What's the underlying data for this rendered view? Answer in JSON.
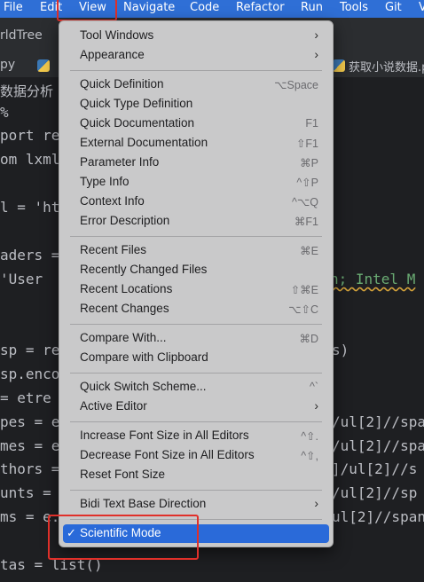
{
  "menubar": {
    "items": [
      "File",
      "Edit",
      "View",
      "Navigate",
      "Code",
      "Refactor",
      "Run",
      "Tools",
      "Git",
      "V"
    ]
  },
  "editor": {
    "project_crumb": "rldTree",
    "tabs": [
      "py",
      "获取小说数据.py"
    ],
    "breadcrumb": "数据分析",
    "lines": [
      {
        "t": "%"
      },
      {
        "t": "port re"
      },
      {
        "t": "om lxml"
      },
      {
        "t": ""
      },
      {
        "t": "l = 'ht"
      },
      {
        "t": ""
      },
      {
        "t": "aders ="
      },
      {
        "t": "  'User",
        "tail": "h; Intel M"
      },
      {
        "t": ""
      },
      {
        "t": ""
      },
      {
        "t": "sp = re",
        "tail": "s)"
      },
      {
        "t": "sp.enco"
      },
      {
        "t": " = etre"
      },
      {
        "t": "pes = e",
        "tail": "/ul[2]//spa"
      },
      {
        "t": "mes = e",
        "tail": "/ul[2]//spa"
      },
      {
        "t": "thors =",
        "tail": "]/ul[2]//s"
      },
      {
        "t": "unts =",
        "tail": "/ul[2]//sp"
      },
      {
        "t": "ms = e.",
        "tail": "ul[2]//span"
      },
      {
        "t": ""
      },
      {
        "t": "tas = list()"
      }
    ]
  },
  "menu": {
    "groups": [
      [
        {
          "label": "Tool Windows",
          "shortcut": "",
          "submenu": true
        },
        {
          "label": "Appearance",
          "shortcut": "",
          "submenu": true
        }
      ],
      [
        {
          "label": "Quick Definition",
          "shortcut": "⌥Space"
        },
        {
          "label": "Quick Type Definition",
          "shortcut": ""
        },
        {
          "label": "Quick Documentation",
          "shortcut": "F1"
        },
        {
          "label": "External Documentation",
          "shortcut": "⇧F1"
        },
        {
          "label": "Parameter Info",
          "shortcut": "⌘P"
        },
        {
          "label": "Type Info",
          "shortcut": "^⇧P"
        },
        {
          "label": "Context Info",
          "shortcut": "^⌥Q"
        },
        {
          "label": "Error Description",
          "shortcut": "⌘F1"
        }
      ],
      [
        {
          "label": "Recent Files",
          "shortcut": "⌘E"
        },
        {
          "label": "Recently Changed Files",
          "shortcut": ""
        },
        {
          "label": "Recent Locations",
          "shortcut": "⇧⌘E"
        },
        {
          "label": "Recent Changes",
          "shortcut": "⌥⇧C"
        }
      ],
      [
        {
          "label": "Compare With...",
          "shortcut": "⌘D"
        },
        {
          "label": "Compare with Clipboard",
          "shortcut": ""
        }
      ],
      [
        {
          "label": "Quick Switch Scheme...",
          "shortcut": "^`"
        },
        {
          "label": "Active Editor",
          "shortcut": "",
          "submenu": true
        }
      ],
      [
        {
          "label": "Increase Font Size in All Editors",
          "shortcut": "^⇧."
        },
        {
          "label": "Decrease Font Size in All Editors",
          "shortcut": "^⇧,"
        },
        {
          "label": "Reset Font Size",
          "shortcut": ""
        }
      ],
      [
        {
          "label": "Bidi Text Base Direction",
          "shortcut": "",
          "submenu": true
        }
      ],
      [
        {
          "label": "Scientific Mode",
          "shortcut": "",
          "checked": true,
          "selected": true
        }
      ]
    ]
  },
  "icons": {
    "submenu": "chevron-right-icon",
    "check": "checkmark-icon"
  },
  "colors": {
    "highlight_box": "#e0302a",
    "menubar": "#2f6fd6",
    "selection": "#2a6ad9"
  }
}
